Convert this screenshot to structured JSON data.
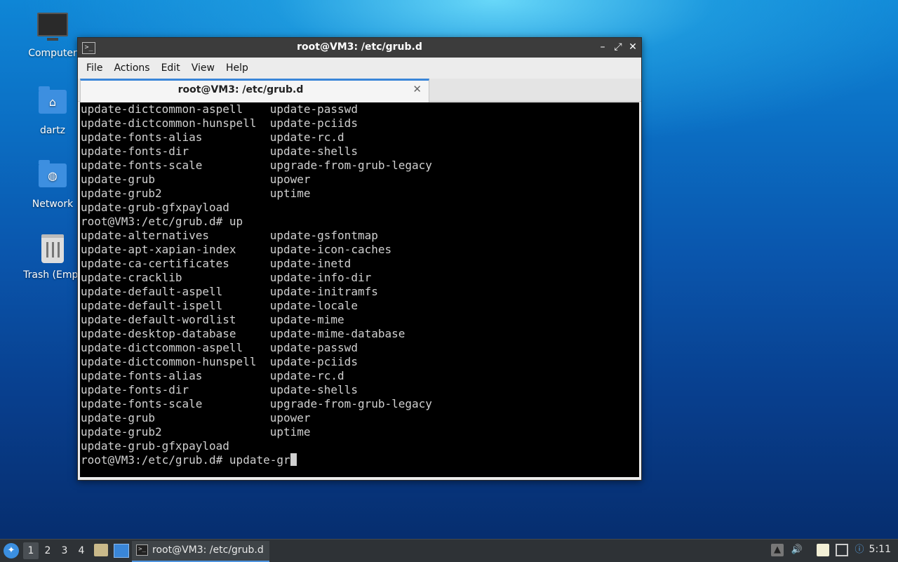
{
  "desktop": {
    "icons": [
      {
        "label": "Computer",
        "icon": "computer-icon"
      },
      {
        "label": "dartz",
        "icon": "home-folder-icon"
      },
      {
        "label": "Network",
        "icon": "network-folder-icon"
      },
      {
        "label": "Trash (Empt",
        "icon": "trash-icon"
      }
    ]
  },
  "window": {
    "title": "root@VM3: /etc/grub.d",
    "menu": [
      "File",
      "Actions",
      "Edit",
      "View",
      "Help"
    ],
    "tab_title": "root@VM3: /etc/grub.d",
    "controls": {
      "minimize": "–",
      "maximize": "⤢",
      "close": "✕"
    }
  },
  "terminal": {
    "lines": [
      "update-dictcommon-aspell    update-passwd",
      "update-dictcommon-hunspell  update-pciids",
      "update-fonts-alias          update-rc.d",
      "update-fonts-dir            update-shells",
      "update-fonts-scale          upgrade-from-grub-legacy",
      "update-grub                 upower",
      "update-grub2                uptime",
      "update-grub-gfxpayload",
      "root@VM3:/etc/grub.d# up",
      "update-alternatives         update-gsfontmap",
      "update-apt-xapian-index     update-icon-caches",
      "update-ca-certificates      update-inetd",
      "update-cracklib             update-info-dir",
      "update-default-aspell       update-initramfs",
      "update-default-ispell       update-locale",
      "update-default-wordlist     update-mime",
      "update-desktop-database     update-mime-database",
      "update-dictcommon-aspell    update-passwd",
      "update-dictcommon-hunspell  update-pciids",
      "update-fonts-alias          update-rc.d",
      "update-fonts-dir            update-shells",
      "update-fonts-scale          upgrade-from-grub-legacy",
      "update-grub                 upower",
      "update-grub2                uptime",
      "update-grub-gfxpayload"
    ],
    "prompt": "root@VM3:/etc/grub.d# update-gr"
  },
  "taskbar": {
    "workspaces": [
      "1",
      "2",
      "3",
      "4"
    ],
    "active_workspace": "1",
    "task_label": "root@VM3: /etc/grub.d",
    "clock": "5:11"
  }
}
